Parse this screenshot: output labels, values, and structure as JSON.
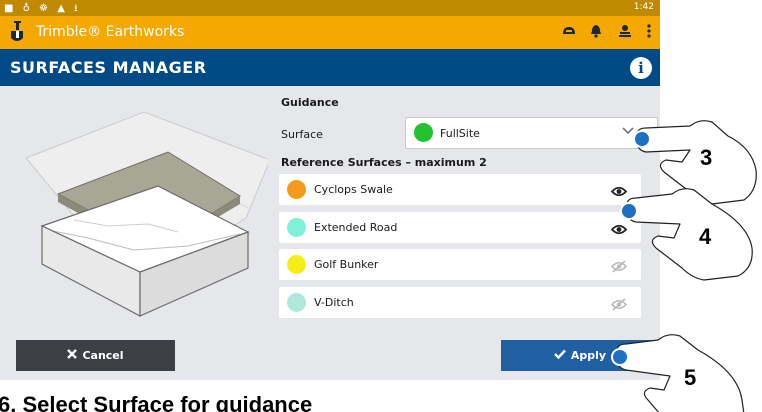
{
  "status_bar": {
    "time": "1:42"
  },
  "app": {
    "title": "Trimble® Earthworks"
  },
  "page": {
    "title": "SURFACES MANAGER"
  },
  "guidance": {
    "heading": "Guidance",
    "surface_label": "Surface",
    "surface_value": "FullSite",
    "surface_color": "#22c32e"
  },
  "references": {
    "heading": "Reference Surfaces – maximum 2",
    "items": [
      {
        "name": "Cyclops Swale",
        "color": "#f59b1c",
        "visible": true
      },
      {
        "name": "Extended Road",
        "color": "#7ef2d8",
        "visible": true
      },
      {
        "name": "Golf Bunker",
        "color": "#f6ec17",
        "visible": false
      },
      {
        "name": "V-Ditch",
        "color": "#b0e8de",
        "visible": false
      }
    ]
  },
  "buttons": {
    "cancel": "Cancel",
    "apply": "Apply"
  },
  "steps": [
    "3",
    "4",
    "5"
  ],
  "caption": "6. Select Surface for guidance"
}
